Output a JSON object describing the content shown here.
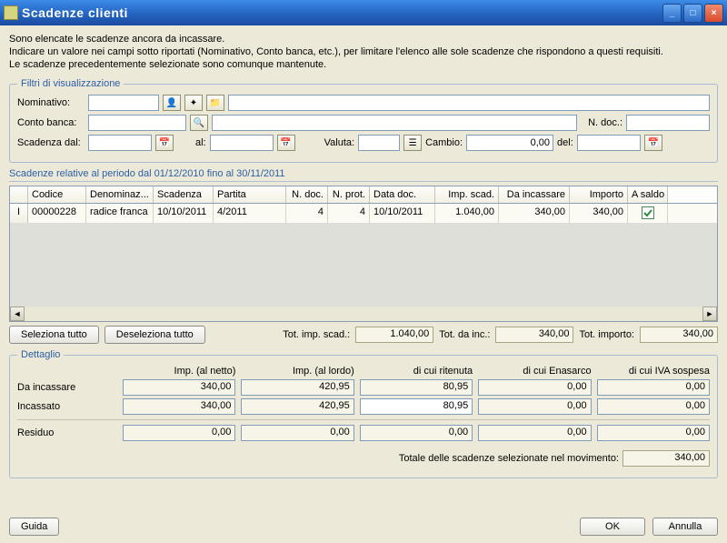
{
  "title": "Scadenze clienti",
  "intro": {
    "line1": "Sono elencate le scadenze ancora da incassare.",
    "line2": "Indicare un valore nei campi sotto riportati (Nominativo, Conto banca, etc.), per limitare l'elenco alle sole scadenze che rispondono a questi requisiti.",
    "line3": "Le scadenze precedentemente selezionate sono comunque mantenute."
  },
  "filters": {
    "legend": "Filtri di visualizzazione",
    "nominativo_label": "Nominativo:",
    "nominativo_value": "",
    "nominativo_desc": "",
    "conto_label": "Conto banca:",
    "conto_value": "",
    "conto_desc": "",
    "ndoc_label": "N. doc.:",
    "ndoc_value": "",
    "scad_dal_label": "Scadenza dal:",
    "scad_dal_value": "",
    "scad_al_label": "al:",
    "scad_al_value": "",
    "valuta_label": "Valuta:",
    "valuta_value": "",
    "cambio_label": "Cambio:",
    "cambio_value": "0,00",
    "cambio_del_label": "del:",
    "cambio_del_value": ""
  },
  "grid": {
    "title": "Scadenze relative al periodo dal 01/12/2010 fino al 30/11/2011",
    "cols": {
      "codice": "Codice",
      "denom": "Denominaz...",
      "scadenza": "Scadenza",
      "partita": "Partita",
      "ndoc": "N. doc.",
      "nprot": "N. prot.",
      "datadoc": "Data doc.",
      "impscad": "Imp. scad.",
      "dainc": "Da incassare",
      "importo": "Importo",
      "asaldo": "A saldo"
    },
    "row": {
      "marker": "I",
      "codice": "00000228",
      "denom": "radice franca",
      "scadenza": "10/10/2011",
      "partita": "4/2011",
      "ndoc": "4",
      "nprot": "4",
      "datadoc": "10/10/2011",
      "impscad": "1.040,00",
      "dainc": "340,00",
      "importo": "340,00"
    }
  },
  "selectbtns": {
    "select_all": "Seleziona tutto",
    "deselect_all": "Deseleziona tutto"
  },
  "totals": {
    "tot_imp_label": "Tot. imp. scad.:",
    "tot_imp_value": "1.040,00",
    "tot_dainc_label": "Tot. da inc.:",
    "tot_dainc_value": "340,00",
    "tot_importo_label": "Tot. importo:",
    "tot_importo_value": "340,00"
  },
  "detail": {
    "legend": "Dettaglio",
    "h_netto": "Imp. (al netto)",
    "h_lordo": "Imp. (al lordo)",
    "h_rit": "di cui ritenuta",
    "h_enas": "di cui Enasarco",
    "h_iva": "di cui IVA sospesa",
    "r_dainc": "Da incassare",
    "r_inc": "Incassato",
    "r_res": "Residuo",
    "dainc": {
      "netto": "340,00",
      "lordo": "420,95",
      "rit": "80,95",
      "enas": "0,00",
      "iva": "0,00"
    },
    "inc": {
      "netto": "340,00",
      "lordo": "420,95",
      "rit": "80,95",
      "enas": "0,00",
      "iva": "0,00"
    },
    "res": {
      "netto": "0,00",
      "lordo": "0,00",
      "rit": "0,00",
      "enas": "0,00",
      "iva": "0,00"
    },
    "total_label": "Totale delle scadenze selezionate nel movimento:",
    "total_value": "340,00"
  },
  "footer": {
    "guida": "Guida",
    "ok": "OK",
    "annulla": "Annulla"
  }
}
